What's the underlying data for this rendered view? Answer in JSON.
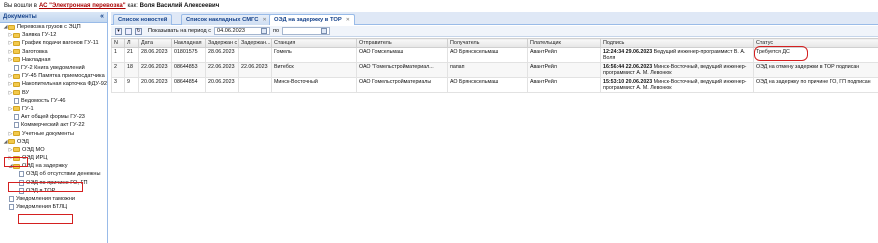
{
  "topbar": {
    "prefix": "Вы вошли в",
    "system": "АС \"Электронная перевозка\"",
    "as_label": "как:",
    "user": "Воля Василий Алексеевич"
  },
  "left": {
    "title": "Документы",
    "collapse_icon": "double-chevron-left-icon",
    "items": [
      {
        "label": "Перевозка грузов с ЭЦП",
        "kind": "folder",
        "indent": 0,
        "expanded": true
      },
      {
        "label": "Заявка ГУ-12",
        "kind": "folder",
        "indent": 1
      },
      {
        "label": "График подачи вагонов ГУ-11",
        "kind": "folder",
        "indent": 1
      },
      {
        "label": "Заготовка",
        "kind": "folder",
        "indent": 1
      },
      {
        "label": "Накладная",
        "kind": "folder",
        "indent": 1
      },
      {
        "label": "ГУ-2 Книга уведомлений",
        "kind": "doc",
        "indent": 1
      },
      {
        "label": "ГУ-45 Памятка приемосдатчика",
        "kind": "folder",
        "indent": 1
      },
      {
        "label": "Накопительная карточка ФДУ-92",
        "kind": "folder",
        "indent": 1
      },
      {
        "label": "ВУ",
        "kind": "folder",
        "indent": 1
      },
      {
        "label": "Ведомость ГУ-46",
        "kind": "doc",
        "indent": 1
      },
      {
        "label": "ГУ-1",
        "kind": "folder",
        "indent": 1
      },
      {
        "label": "Акт общей формы ГУ-23",
        "kind": "doc",
        "indent": 1
      },
      {
        "label": "Коммерческий акт ГУ-22",
        "kind": "doc",
        "indent": 1
      },
      {
        "label": "Учетные документы",
        "kind": "folder",
        "indent": 1
      },
      {
        "label": "ОЭД",
        "kind": "folder",
        "indent": 0,
        "expanded": true
      },
      {
        "label": "ОЭД МО",
        "kind": "folder",
        "indent": 1
      },
      {
        "label": "ОЭД ИРЦ",
        "kind": "folder",
        "indent": 1
      },
      {
        "label": "ОЭД на задержку",
        "kind": "folder",
        "indent": 1,
        "expanded": true
      },
      {
        "label": "ОЭД об отсутствии денежны",
        "kind": "doc",
        "indent": 2
      },
      {
        "label": "ОЭД по причине ГО, ГП",
        "kind": "doc",
        "indent": 2
      },
      {
        "label": "ОЭД в ТОР",
        "kind": "doc",
        "indent": 2
      },
      {
        "label": "Уведомления таможни",
        "kind": "doc",
        "indent": 0
      },
      {
        "label": "Уведомления БТЛЦ",
        "kind": "doc",
        "indent": 0
      }
    ]
  },
  "tabs": [
    {
      "label": "Список новостей"
    },
    {
      "label": "Список накладных СМГС"
    },
    {
      "label": "ОЭД на задержку в ТОР"
    }
  ],
  "toolbar": {
    "period_label": "Показывать на период с",
    "date_from": "04.06.2023",
    "to_label": "по",
    "date_to": ""
  },
  "table": {
    "columns": [
      "N",
      "Л",
      "Дата",
      "Накладная",
      "Задержан с",
      "Задержан...",
      "Станция",
      "Отправитель",
      "Получатель",
      "Плательщик",
      "Подпись",
      "Статус"
    ],
    "rows": [
      {
        "n": "1",
        "l": "21",
        "date": "28.06.2023",
        "waybill": "01801575",
        "from": "28.06.2023",
        "to": "",
        "station": "Гомель",
        "sender": "ОАО Гомсельмаш",
        "receiver": "АО Брянсксельмаш",
        "payer": "АвантРейл",
        "sig_time": "12:24:34 29.06.2023",
        "sig_text": "Ведущий инженер-программист В. А. Воля",
        "status": "Требуется ДС"
      },
      {
        "n": "2",
        "l": "18",
        "date": "22.06.2023",
        "waybill": "08644853",
        "from": "22.06.2023",
        "to": "22.06.2023",
        "station": "Витебск",
        "sender": "ОАО \"Гомельстройматериал...",
        "receiver": "папап",
        "payer": "АвантРейл",
        "sig_time": "16:56:44 22.06.2023",
        "sig_text": "Минск-Восточный, ведущий инженер-программист А. М. Левонюк",
        "status": "ОЭД на отмену задержки в ТОР подписан"
      },
      {
        "n": "3",
        "l": "9",
        "date": "20.06.2023",
        "waybill": "08644854",
        "from": "20.06.2023",
        "to": "",
        "station": "Минск-Восточный",
        "sender": "ОАО Гомельстройматериалы",
        "receiver": "АО Брянсксельмаш",
        "payer": "АвантРейл",
        "sig_time": "15:53:10 20.06.2023",
        "sig_text": "Минск-Восточный, ведущий инженер-программист А. М. Левонюк",
        "status": "ОЭД на задержку по причине ГО, ГП подписан"
      }
    ]
  },
  "colors": {
    "highlight": "#d42020",
    "header_blue": "#15428b",
    "link_red": "#aa0000"
  }
}
